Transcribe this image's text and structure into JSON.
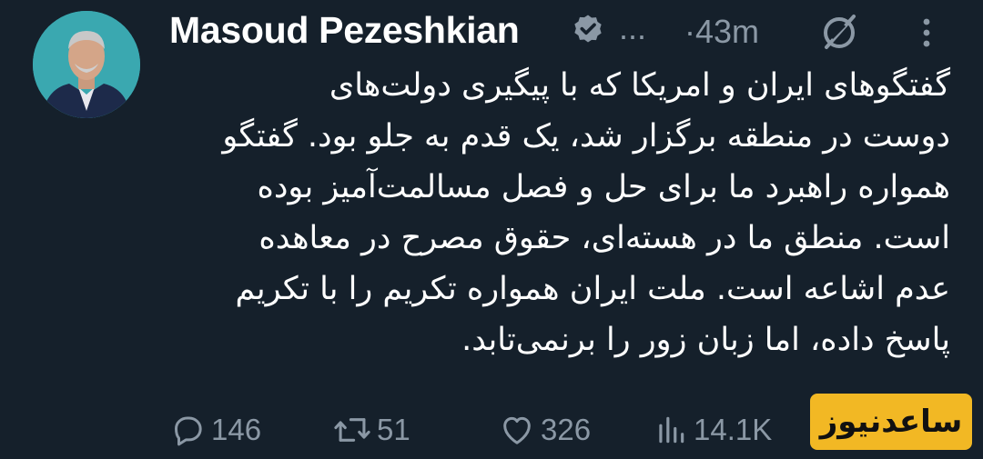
{
  "author": {
    "name": "Masoud Pezeshkian",
    "handle": "...",
    "time": "·43m"
  },
  "tweet": {
    "lines": [
      "گفتگوهای ایران و امریکا که با پیگیری دولت‌های",
      "دوست در منطقه برگزار شد، یک قدم به جلو بود. گفتگو",
      "همواره راهبرد ما برای حل و فصل مسالمت‌آمیز بوده",
      "است. منطق ما در هسته‌ای، حقوق مصرح در معاهده",
      "عدم اشاعه است. ملت ایران همواره تکریم را با تکریم",
      "پاسخ داده، اما زبان زور را برنمی‌تابد."
    ]
  },
  "actions": {
    "replies": "146",
    "retweets": "51",
    "likes": "326",
    "views": "14.1K"
  },
  "watermark": {
    "text": "ساعدنیوز"
  },
  "icons": {
    "verified": "verified-badge-icon",
    "grok": "grok-icon",
    "more": "more-vertical-icon",
    "reply": "reply-icon",
    "retweet": "retweet-icon",
    "like": "heart-icon",
    "views": "views-chart-icon"
  },
  "colors": {
    "background": "#15202b",
    "text": "#ffffff",
    "secondary": "#8b98a5",
    "watermark_bg": "#f2b824"
  }
}
